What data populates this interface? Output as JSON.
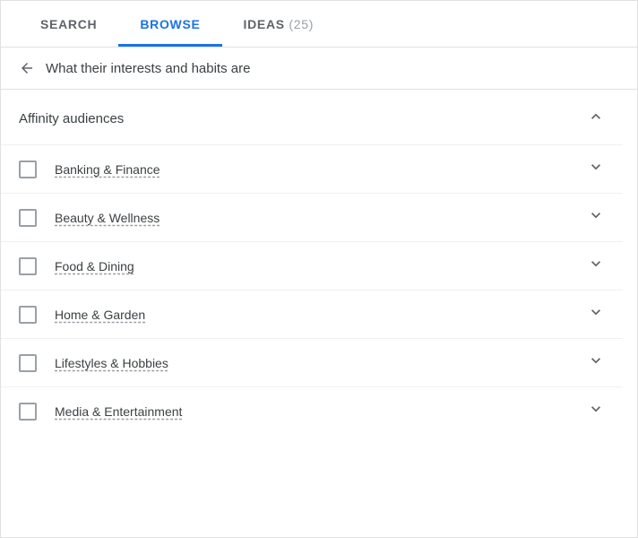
{
  "tabs": [
    {
      "id": "search",
      "label": "SEARCH",
      "active": false
    },
    {
      "id": "browse",
      "label": "BROWSE",
      "active": true
    },
    {
      "id": "ideas",
      "label": "IDEAS",
      "count": "(25)",
      "active": false
    }
  ],
  "backNav": {
    "title": "What their interests and habits are"
  },
  "section": {
    "title": "Affinity audiences",
    "expanded": true
  },
  "categories": [
    {
      "id": "banking",
      "label": "Banking & Finance"
    },
    {
      "id": "beauty",
      "label": "Beauty & Wellness"
    },
    {
      "id": "food",
      "label": "Food & Dining"
    },
    {
      "id": "home",
      "label": "Home & Garden"
    },
    {
      "id": "lifestyles",
      "label": "Lifestyles & Hobbies"
    },
    {
      "id": "media",
      "label": "Media & Entertainment"
    }
  ]
}
